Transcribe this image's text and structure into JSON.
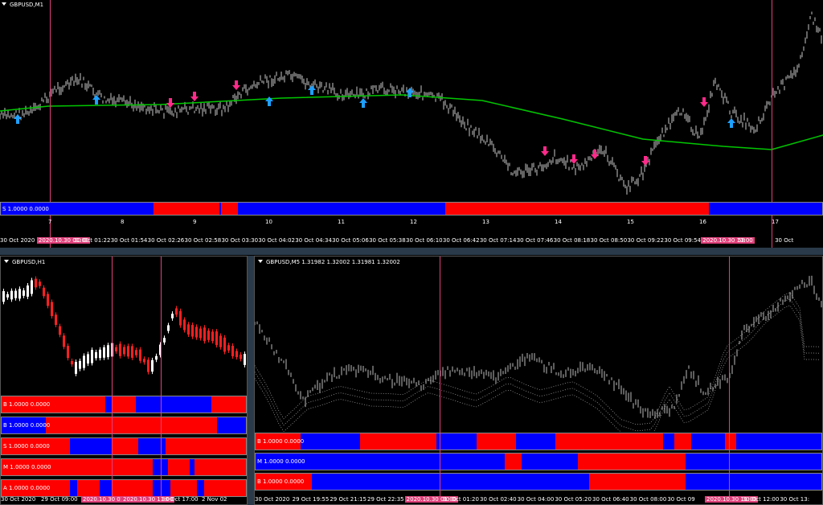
{
  "colors": {
    "bull": "#0000ff",
    "bear": "#ff0000",
    "marker": "#e0407a",
    "ma": "#00c800",
    "up_arrow": "#1ea0ff",
    "down_arrow": "#ff2a8a",
    "candle_up": "#ffffff",
    "candle_down": "#ff2020"
  },
  "main": {
    "title": "GBPUSD,M1",
    "strip_label": "S 1.0000 0.0000",
    "scale_labels": [
      "7",
      "8",
      "9",
      "10",
      "11",
      "12",
      "13",
      "14",
      "15",
      "16",
      "17"
    ],
    "time_labels": [
      "30 Oct 2020",
      "2020.10.30 01:00",
      "30 Oct 01:22",
      "30 Oct 01:54",
      "30 Oct 02:26",
      "30 Oct 02:58",
      "30 Oct 03:30",
      "30 Oct 04:02",
      "30 Oct 04:34",
      "30 Oct 05:06",
      "30 Oct 05:38",
      "30 Oct 06:10",
      "30 Oct 06:42",
      "30 Oct 07:14",
      "30 Oct 07:46",
      "30 Oct 08:18",
      "30 Oct 08:50",
      "30 Oct 09:22",
      "30 Oct 09:54",
      "2020.10.30 11:00",
      "58",
      "30 Oct"
    ],
    "strip_segments": [
      {
        "from": 0.0,
        "to": 0.186,
        "c": "bull"
      },
      {
        "from": 0.186,
        "to": 0.266,
        "c": "bear"
      },
      {
        "from": 0.266,
        "to": 0.268,
        "c": "bull"
      },
      {
        "from": 0.268,
        "to": 0.289,
        "c": "bear"
      },
      {
        "from": 0.289,
        "to": 0.541,
        "c": "bull"
      },
      {
        "from": 0.541,
        "to": 0.862,
        "c": "bear"
      },
      {
        "from": 0.862,
        "to": 1.0,
        "c": "bull"
      }
    ]
  },
  "h1": {
    "title": "GBPUSD,H1",
    "time_labels": [
      "30 Oct 2020",
      "29 Oct 09:00",
      "2020.10.30 01:00",
      "2020.10.30 11:00",
      "30 Oct 17:00",
      "2 Nov 02"
    ],
    "strips": [
      {
        "label": "B 1.0000 0.0000",
        "segments": [
          {
            "from": 0,
            "to": 0.425,
            "c": "bear"
          },
          {
            "from": 0.425,
            "to": 0.455,
            "c": "bull"
          },
          {
            "from": 0.455,
            "to": 0.55,
            "c": "bear"
          },
          {
            "from": 0.55,
            "to": 0.86,
            "c": "bull"
          },
          {
            "from": 0.86,
            "to": 1,
            "c": "bear"
          }
        ]
      },
      {
        "label": "B 1.0000 0.0000",
        "segments": [
          {
            "from": 0,
            "to": 0.18,
            "c": "bull"
          },
          {
            "from": 0.18,
            "to": 0.88,
            "c": "bear"
          },
          {
            "from": 0.88,
            "to": 1,
            "c": "bull"
          }
        ]
      },
      {
        "label": "S 1.0000 0.0000",
        "segments": [
          {
            "from": 0,
            "to": 0.28,
            "c": "bear"
          },
          {
            "from": 0.28,
            "to": 0.45,
            "c": "bull"
          },
          {
            "from": 0.45,
            "to": 0.56,
            "c": "bear"
          },
          {
            "from": 0.56,
            "to": 0.67,
            "c": "bull"
          },
          {
            "from": 0.67,
            "to": 1,
            "c": "bear"
          }
        ]
      },
      {
        "label": "M 1.0000 0.0000",
        "segments": [
          {
            "from": 0,
            "to": 0.62,
            "c": "bear"
          },
          {
            "from": 0.62,
            "to": 0.68,
            "c": "bull"
          },
          {
            "from": 0.68,
            "to": 0.77,
            "c": "bear"
          },
          {
            "from": 0.77,
            "to": 0.79,
            "c": "bull"
          },
          {
            "from": 0.79,
            "to": 1,
            "c": "bear"
          }
        ]
      },
      {
        "label": "A 1.0000 0.0000",
        "segments": [
          {
            "from": 0,
            "to": 0.28,
            "c": "bear"
          },
          {
            "from": 0.28,
            "to": 0.31,
            "c": "bull"
          },
          {
            "from": 0.31,
            "to": 0.4,
            "c": "bear"
          },
          {
            "from": 0.4,
            "to": 0.45,
            "c": "bull"
          },
          {
            "from": 0.45,
            "to": 0.62,
            "c": "bear"
          },
          {
            "from": 0.62,
            "to": 0.69,
            "c": "bull"
          },
          {
            "from": 0.69,
            "to": 0.8,
            "c": "bear"
          },
          {
            "from": 0.8,
            "to": 0.83,
            "c": "bull"
          },
          {
            "from": 0.83,
            "to": 1,
            "c": "bear"
          }
        ]
      }
    ]
  },
  "m5": {
    "title": "GBPUSD,M5  1.31982 1.32002 1.31981 1.32002",
    "time_labels": [
      "30 Oct 2020",
      "29 Oct 19:55",
      "29 Oct 21:15",
      "29 Oct 22:35",
      "2020.10.30 01:00",
      "30 Oct 01:20",
      "30 Oct 02:40",
      "30 Oct 04:00",
      "30 Oct 05:20",
      "30 Oct 06:40",
      "30 Oct 08:00",
      "30 Oct 09",
      "2020.10.30 11:00",
      "30 Oct 12:00",
      "30 Oct 13:"
    ],
    "strips": [
      {
        "label": "B 1.0000 0.0000",
        "segments": [
          {
            "from": 0,
            "to": 0.08,
            "c": "bear"
          },
          {
            "from": 0.08,
            "to": 0.185,
            "c": "bull"
          },
          {
            "from": 0.185,
            "to": 0.32,
            "c": "bear"
          },
          {
            "from": 0.32,
            "to": 0.39,
            "c": "bull"
          },
          {
            "from": 0.39,
            "to": 0.46,
            "c": "bear"
          },
          {
            "from": 0.46,
            "to": 0.53,
            "c": "bull"
          },
          {
            "from": 0.53,
            "to": 0.72,
            "c": "bear"
          },
          {
            "from": 0.72,
            "to": 0.74,
            "c": "bull"
          },
          {
            "from": 0.74,
            "to": 0.77,
            "c": "bear"
          },
          {
            "from": 0.77,
            "to": 0.83,
            "c": "bull"
          },
          {
            "from": 0.83,
            "to": 0.85,
            "c": "bear"
          },
          {
            "from": 0.85,
            "to": 1,
            "c": "bull"
          }
        ]
      },
      {
        "label": "M 1.0000 0.0000",
        "segments": [
          {
            "from": 0,
            "to": 0.44,
            "c": "bull"
          },
          {
            "from": 0.44,
            "to": 0.47,
            "c": "bear"
          },
          {
            "from": 0.47,
            "to": 0.57,
            "c": "bull"
          },
          {
            "from": 0.57,
            "to": 0.76,
            "c": "bear"
          },
          {
            "from": 0.76,
            "to": 1,
            "c": "bull"
          }
        ]
      },
      {
        "label": "B 1.0000 0.0000",
        "segments": [
          {
            "from": 0,
            "to": 0.1,
            "c": "bear"
          },
          {
            "from": 0.1,
            "to": 0.59,
            "c": "bull"
          },
          {
            "from": 0.59,
            "to": 0.76,
            "c": "bear"
          },
          {
            "from": 0.76,
            "to": 1,
            "c": "bull"
          }
        ]
      }
    ]
  }
}
